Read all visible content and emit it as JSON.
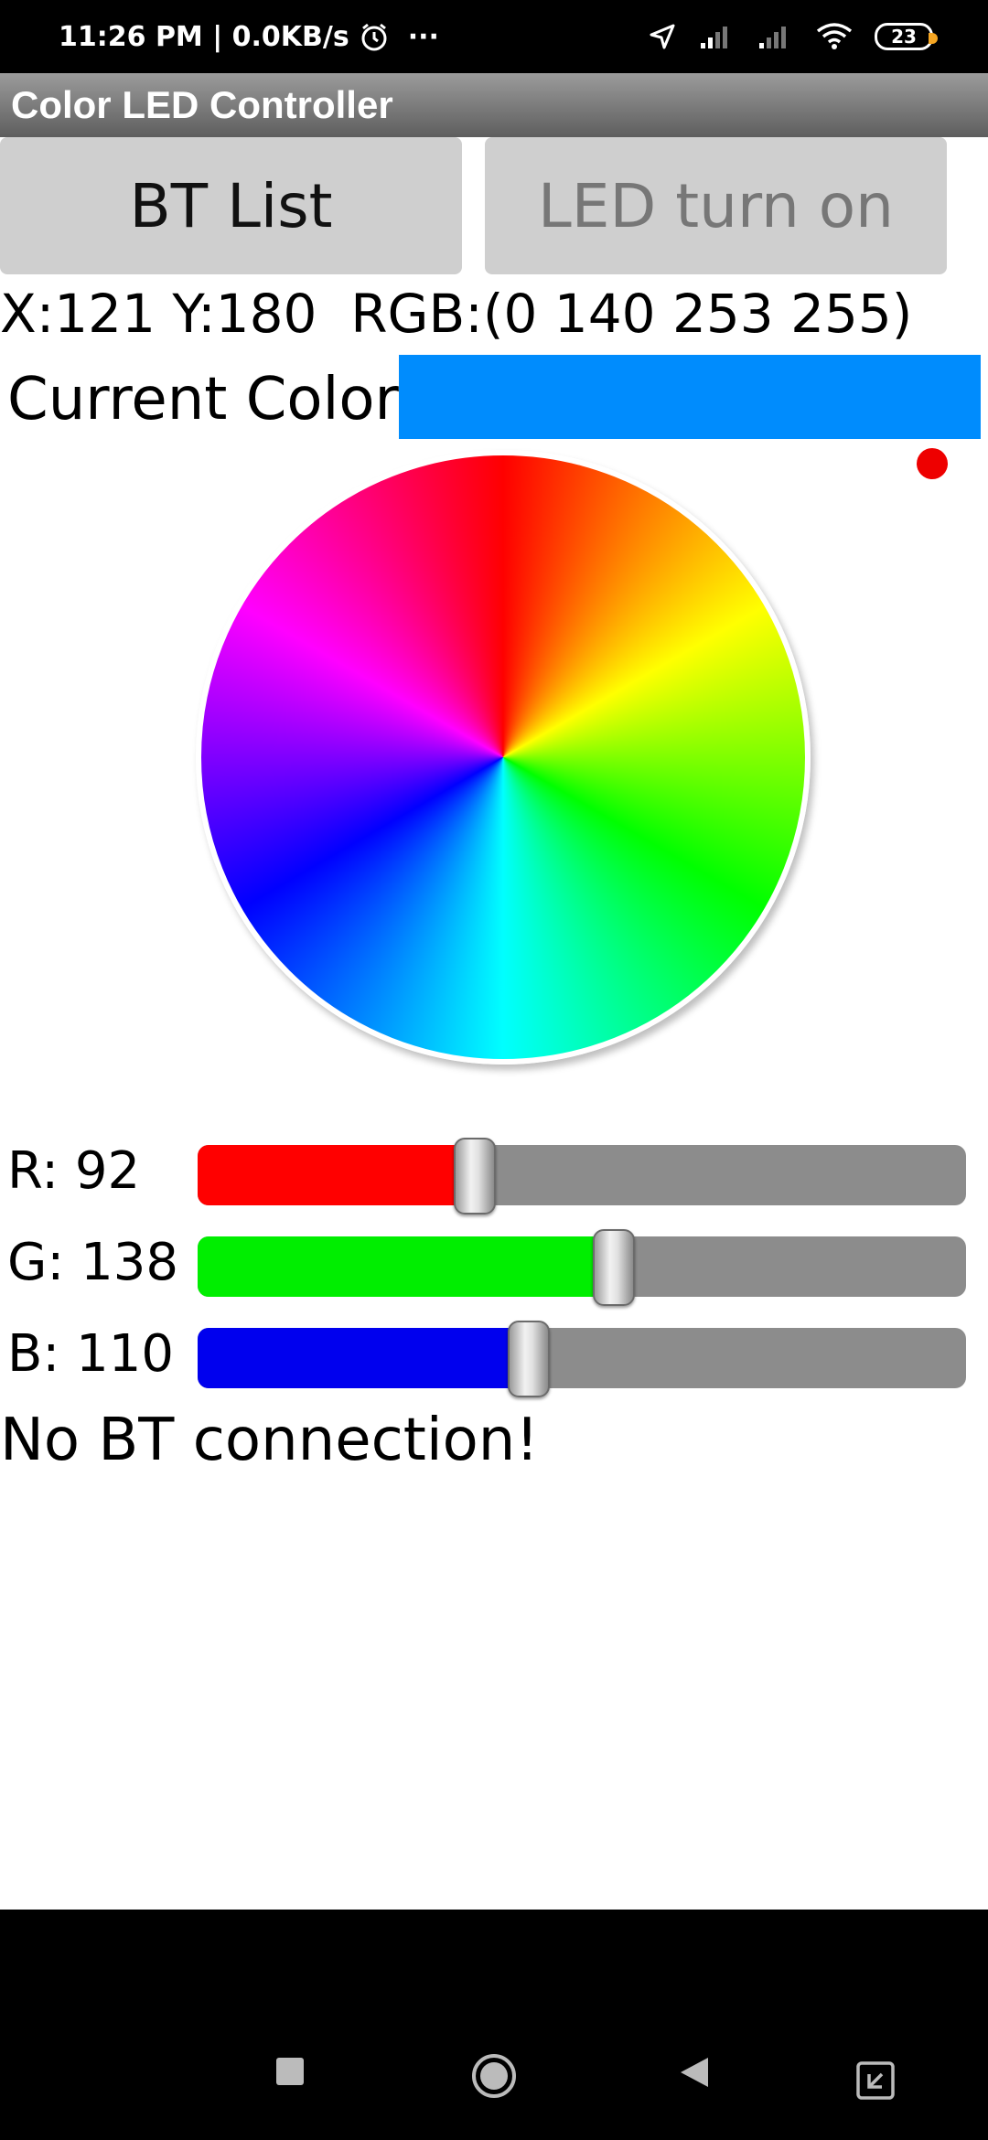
{
  "status_bar": {
    "time": "11:26 PM | 0.0KB/s",
    "more": "···",
    "battery": "23"
  },
  "app": {
    "title": "Color LED Controller"
  },
  "buttons": {
    "bt_list": "BT List",
    "led_turn_on": "LED turn on"
  },
  "readout": "X:121 Y:180  RGB:(0 140 253 255)",
  "current_color": {
    "label": "Current Color:",
    "color": "#008cfd"
  },
  "sliders": [
    {
      "label": "R: 92",
      "value": 92,
      "max": 255,
      "color": "#ff0000"
    },
    {
      "label": "G: 138",
      "value": 138,
      "max": 255,
      "color": "#00ee00"
    },
    {
      "label": "B: 110",
      "value": 110,
      "max": 255,
      "color": "#0000ee"
    }
  ],
  "connection_status": "No BT connection!",
  "nav": [
    "recents-icon",
    "home-icon",
    "back-icon",
    "screenshot-icon"
  ]
}
